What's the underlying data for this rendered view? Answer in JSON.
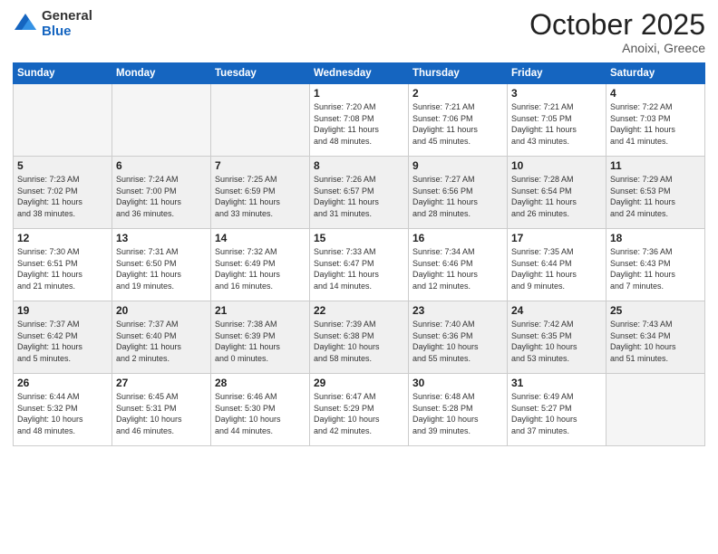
{
  "header": {
    "logo": {
      "general": "General",
      "blue": "Blue"
    },
    "title": "October 2025",
    "location": "Anoixi, Greece"
  },
  "weekdays": [
    "Sunday",
    "Monday",
    "Tuesday",
    "Wednesday",
    "Thursday",
    "Friday",
    "Saturday"
  ],
  "weeks": [
    [
      {
        "day": "",
        "info": ""
      },
      {
        "day": "",
        "info": ""
      },
      {
        "day": "",
        "info": ""
      },
      {
        "day": "1",
        "info": "Sunrise: 7:20 AM\nSunset: 7:08 PM\nDaylight: 11 hours\nand 48 minutes."
      },
      {
        "day": "2",
        "info": "Sunrise: 7:21 AM\nSunset: 7:06 PM\nDaylight: 11 hours\nand 45 minutes."
      },
      {
        "day": "3",
        "info": "Sunrise: 7:21 AM\nSunset: 7:05 PM\nDaylight: 11 hours\nand 43 minutes."
      },
      {
        "day": "4",
        "info": "Sunrise: 7:22 AM\nSunset: 7:03 PM\nDaylight: 11 hours\nand 41 minutes."
      }
    ],
    [
      {
        "day": "5",
        "info": "Sunrise: 7:23 AM\nSunset: 7:02 PM\nDaylight: 11 hours\nand 38 minutes."
      },
      {
        "day": "6",
        "info": "Sunrise: 7:24 AM\nSunset: 7:00 PM\nDaylight: 11 hours\nand 36 minutes."
      },
      {
        "day": "7",
        "info": "Sunrise: 7:25 AM\nSunset: 6:59 PM\nDaylight: 11 hours\nand 33 minutes."
      },
      {
        "day": "8",
        "info": "Sunrise: 7:26 AM\nSunset: 6:57 PM\nDaylight: 11 hours\nand 31 minutes."
      },
      {
        "day": "9",
        "info": "Sunrise: 7:27 AM\nSunset: 6:56 PM\nDaylight: 11 hours\nand 28 minutes."
      },
      {
        "day": "10",
        "info": "Sunrise: 7:28 AM\nSunset: 6:54 PM\nDaylight: 11 hours\nand 26 minutes."
      },
      {
        "day": "11",
        "info": "Sunrise: 7:29 AM\nSunset: 6:53 PM\nDaylight: 11 hours\nand 24 minutes."
      }
    ],
    [
      {
        "day": "12",
        "info": "Sunrise: 7:30 AM\nSunset: 6:51 PM\nDaylight: 11 hours\nand 21 minutes."
      },
      {
        "day": "13",
        "info": "Sunrise: 7:31 AM\nSunset: 6:50 PM\nDaylight: 11 hours\nand 19 minutes."
      },
      {
        "day": "14",
        "info": "Sunrise: 7:32 AM\nSunset: 6:49 PM\nDaylight: 11 hours\nand 16 minutes."
      },
      {
        "day": "15",
        "info": "Sunrise: 7:33 AM\nSunset: 6:47 PM\nDaylight: 11 hours\nand 14 minutes."
      },
      {
        "day": "16",
        "info": "Sunrise: 7:34 AM\nSunset: 6:46 PM\nDaylight: 11 hours\nand 12 minutes."
      },
      {
        "day": "17",
        "info": "Sunrise: 7:35 AM\nSunset: 6:44 PM\nDaylight: 11 hours\nand 9 minutes."
      },
      {
        "day": "18",
        "info": "Sunrise: 7:36 AM\nSunset: 6:43 PM\nDaylight: 11 hours\nand 7 minutes."
      }
    ],
    [
      {
        "day": "19",
        "info": "Sunrise: 7:37 AM\nSunset: 6:42 PM\nDaylight: 11 hours\nand 5 minutes."
      },
      {
        "day": "20",
        "info": "Sunrise: 7:37 AM\nSunset: 6:40 PM\nDaylight: 11 hours\nand 2 minutes."
      },
      {
        "day": "21",
        "info": "Sunrise: 7:38 AM\nSunset: 6:39 PM\nDaylight: 11 hours\nand 0 minutes."
      },
      {
        "day": "22",
        "info": "Sunrise: 7:39 AM\nSunset: 6:38 PM\nDaylight: 10 hours\nand 58 minutes."
      },
      {
        "day": "23",
        "info": "Sunrise: 7:40 AM\nSunset: 6:36 PM\nDaylight: 10 hours\nand 55 minutes."
      },
      {
        "day": "24",
        "info": "Sunrise: 7:42 AM\nSunset: 6:35 PM\nDaylight: 10 hours\nand 53 minutes."
      },
      {
        "day": "25",
        "info": "Sunrise: 7:43 AM\nSunset: 6:34 PM\nDaylight: 10 hours\nand 51 minutes."
      }
    ],
    [
      {
        "day": "26",
        "info": "Sunrise: 6:44 AM\nSunset: 5:32 PM\nDaylight: 10 hours\nand 48 minutes."
      },
      {
        "day": "27",
        "info": "Sunrise: 6:45 AM\nSunset: 5:31 PM\nDaylight: 10 hours\nand 46 minutes."
      },
      {
        "day": "28",
        "info": "Sunrise: 6:46 AM\nSunset: 5:30 PM\nDaylight: 10 hours\nand 44 minutes."
      },
      {
        "day": "29",
        "info": "Sunrise: 6:47 AM\nSunset: 5:29 PM\nDaylight: 10 hours\nand 42 minutes."
      },
      {
        "day": "30",
        "info": "Sunrise: 6:48 AM\nSunset: 5:28 PM\nDaylight: 10 hours\nand 39 minutes."
      },
      {
        "day": "31",
        "info": "Sunrise: 6:49 AM\nSunset: 5:27 PM\nDaylight: 10 hours\nand 37 minutes."
      },
      {
        "day": "",
        "info": ""
      }
    ]
  ]
}
